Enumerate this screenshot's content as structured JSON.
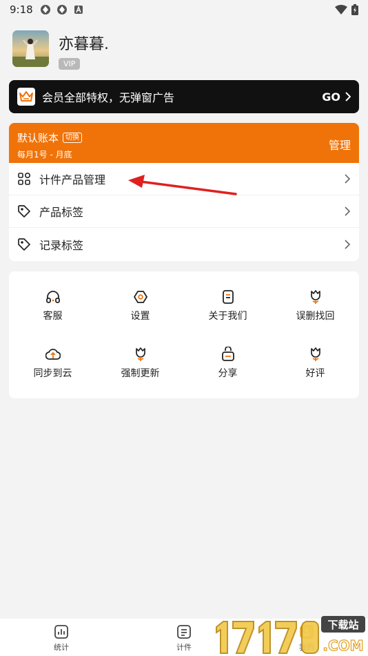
{
  "status_bar": {
    "time": "9:18"
  },
  "profile": {
    "username": "亦暮暮.",
    "badge": "VIP"
  },
  "vip_banner": {
    "text": "会员全部特权，无弹窗广告",
    "action": "GO"
  },
  "account": {
    "name": "默认账本",
    "switch_label": "切换",
    "cycle": "每月1号 - 月底",
    "manage_label": "管理",
    "menu": [
      {
        "label": "计件产品管理",
        "icon": "grid-icon"
      },
      {
        "label": "产品标签",
        "icon": "tag-icon"
      },
      {
        "label": "记录标签",
        "icon": "tag-icon"
      }
    ]
  },
  "tools": [
    {
      "label": "客服",
      "icon": "headset-icon"
    },
    {
      "label": "设置",
      "icon": "settings-icon"
    },
    {
      "label": "关于我们",
      "icon": "document-icon"
    },
    {
      "label": "误删找回",
      "icon": "flower-icon"
    },
    {
      "label": "同步到云",
      "icon": "cloud-upload-icon"
    },
    {
      "label": "强制更新",
      "icon": "flower-icon"
    },
    {
      "label": "分享",
      "icon": "share-icon"
    },
    {
      "label": "好评",
      "icon": "flower-icon"
    }
  ],
  "bottom_nav": [
    {
      "label": "统计",
      "icon": "chart-icon"
    },
    {
      "label": "计件",
      "icon": "list-icon"
    },
    {
      "label": "我的",
      "icon": "user-icon"
    }
  ],
  "watermark": {
    "text": "下载站"
  },
  "colors": {
    "accent": "#f07309",
    "banner": "#111111",
    "background": "#f3f3f3",
    "arrow": "#e02020"
  }
}
